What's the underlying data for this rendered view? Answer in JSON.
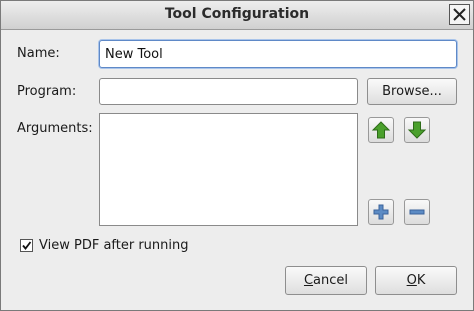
{
  "window": {
    "title": "Tool Configuration"
  },
  "form": {
    "name_label": "Name:",
    "name_value": "New Tool",
    "program_label": "Program:",
    "program_value": "",
    "browse_label": "Browse...",
    "arguments_label": "Arguments:",
    "arguments": []
  },
  "options": {
    "view_pdf_label": "View PDF after running",
    "view_pdf_checked": true
  },
  "buttons": {
    "cancel_first": "C",
    "cancel_rest": "ancel",
    "ok_first": "O",
    "ok_rest": "K"
  },
  "icons": {
    "move_up": "arrow-up-icon",
    "move_down": "arrow-down-icon",
    "add": "plus-icon",
    "remove": "minus-icon",
    "close": "close-icon"
  },
  "colors": {
    "arrow_green": "#4aa02c",
    "plus_blue": "#5c8bc4",
    "focus_border": "#5f89c7"
  }
}
